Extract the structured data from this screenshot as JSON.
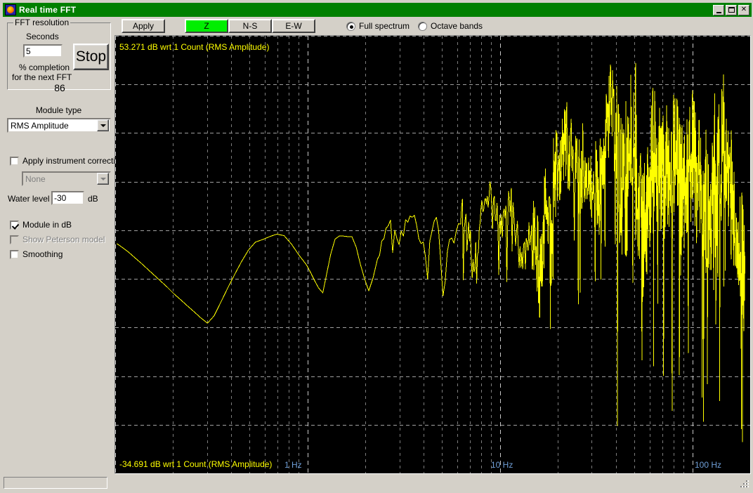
{
  "window": {
    "title": "Real time FFT",
    "icon": "app-icon",
    "buttons": {
      "minimize": "_",
      "maximize": "□",
      "close": "✕"
    }
  },
  "sidebar": {
    "fft_group": {
      "legend": "FFT resolution",
      "seconds_label": "Seconds",
      "seconds_value": "5",
      "stop_button": "Stop",
      "completion_line1": "% completion",
      "completion_line2": "for the next FFT",
      "completion_value": "86"
    },
    "module_type_label": "Module type",
    "module_type_value": "RMS Amplitude",
    "apply_instrument_correction": {
      "label": "Apply instrument correction",
      "checked": false,
      "combo_value": "None",
      "combo_disabled": true
    },
    "water_level": {
      "label": "Water level",
      "value": "-30",
      "unit": "dB"
    },
    "module_in_db": {
      "label": "Module in dB",
      "checked": true,
      "disabled": false
    },
    "show_peterson_model": {
      "label": "Show Peterson model",
      "checked": false,
      "disabled": true
    },
    "smoothing": {
      "label": "Smoothing",
      "checked": false,
      "disabled": false
    }
  },
  "toolbar": {
    "apply_label": "Apply",
    "channel_buttons": [
      {
        "label": "Z",
        "active": true
      },
      {
        "label": "N-S",
        "active": false
      },
      {
        "label": "E-W",
        "active": false
      }
    ],
    "active_channel_color": "#00ee00",
    "spectrum_mode": [
      {
        "label": "Full spectrum",
        "selected": true
      },
      {
        "label": "Octave bands",
        "selected": false
      }
    ]
  },
  "chart_data": {
    "type": "line",
    "title": "",
    "top_label": "53.271 dB wrt 1 Count (RMS Amplitude)",
    "bottom_label": "-34.691 dB wrt 1 Count (RMS Amplitude)",
    "xlabel": "",
    "ylabel": "dB wrt 1 Count (RMS Amplitude)",
    "xscale": "log",
    "xlim": [
      0.1,
      200
    ],
    "ylim": [
      -34.691,
      53.271
    ],
    "ytick_count": 9,
    "grid": true,
    "grid_color": "#a0a0a0",
    "background": "#000000",
    "trace_color": "#ffff00",
    "xticks": [
      {
        "value": 1,
        "label": "1 Hz"
      },
      {
        "value": 10,
        "label": "10 Hz"
      },
      {
        "value": 100,
        "label": "100 Hz"
      }
    ],
    "xtick_label_color": "#6f9fd8",
    "series": [
      {
        "name": "Z",
        "x": [
          0.102,
          0.11,
          0.118,
          0.127,
          0.137,
          0.148,
          0.16,
          0.173,
          0.187,
          0.202,
          0.219,
          0.237,
          0.257,
          0.278,
          0.302,
          0.327,
          0.355,
          0.385,
          0.418,
          0.454,
          0.493,
          0.536,
          0.583,
          0.635,
          0.692,
          0.755,
          0.825,
          0.902,
          0.988,
          1.04,
          1.09,
          1.14,
          1.2,
          1.26,
          1.32,
          1.39,
          1.46,
          1.54,
          1.62,
          1.7,
          1.79,
          1.88,
          1.98,
          2.08,
          2.19,
          2.31,
          2.43,
          2.56,
          2.7,
          2.84,
          2.99,
          3.15,
          3.32,
          3.5,
          3.69,
          3.89,
          4.1,
          4.32,
          4.55,
          4.8,
          5.06,
          5.33,
          5.62,
          5.93,
          6.25,
          6.59,
          6.95,
          7.33,
          7.73,
          8.15,
          8.59,
          9.06,
          9.56,
          10.08,
          10.63,
          11.21,
          11.82,
          12.46,
          13.14,
          13.86,
          14.62,
          15.42,
          16.26,
          17.15,
          18.09,
          19.08,
          20.12,
          21.22,
          22.38,
          23.6,
          24.89,
          26.25,
          27.68,
          29.19,
          30.79,
          32.47,
          34.25,
          36.12,
          38.09,
          40.17,
          42.37,
          44.69,
          47.13,
          49.7,
          52.42,
          55.28,
          58.3,
          61.48,
          64.84,
          68.38,
          72.11,
          76.05,
          80.2,
          84.58,
          89.2,
          94.07,
          99.21,
          104.6,
          110.3,
          116.4,
          122.7,
          129.4,
          136.5,
          144.0,
          151.8,
          160.2,
          169.0,
          178.2,
          187.9,
          198.2
        ],
        "y": [
          11.5,
          10.6,
          9.7,
          8.6,
          7.5,
          6.3,
          5.1,
          3.9,
          2.7,
          1.4,
          0.2,
          -1.0,
          -2.2,
          -3.4,
          -4.5,
          -3.0,
          -0.2,
          2.6,
          5.3,
          7.9,
          10.2,
          11.8,
          12.3,
          12.9,
          13.4,
          13.1,
          11.4,
          9.2,
          7.2,
          5.6,
          4.0,
          2.6,
          1.6,
          5.6,
          9.4,
          12.4,
          13.0,
          13.0,
          12.9,
          12.9,
          10.8,
          7.4,
          4.4,
          2.0,
          4.6,
          8.4,
          12.0,
          14.6,
          16.2,
          14.2,
          11.3,
          13.0,
          15.8,
          16.8,
          15.2,
          11.5,
          8.9,
          12.0,
          16.0,
          14.2,
          1.0,
          9.9,
          12.6,
          14.0,
          15.4,
          16.2,
          12.0,
          5.8,
          9.8,
          17.9,
          21.0,
          19.4,
          16.1,
          13.4,
          16.6,
          20.2,
          17.1,
          10.5,
          6.4,
          11.7,
          15.2,
          11.0,
          4.0,
          17.5,
          21.0,
          24.5,
          26.8,
          29.5,
          31.2,
          28.0,
          24.5,
          26.6,
          28.8,
          26.0,
          21.9,
          24.8,
          30.0,
          34.2,
          40.8,
          31.0,
          24.0,
          20.4,
          26.2,
          29.0,
          22.5,
          12.3,
          18.6,
          27.0,
          29.4,
          28.0,
          24.6,
          27.8,
          31.2,
          26.4,
          20.5,
          24.0,
          28.8,
          26.0,
          22.2,
          18.0,
          14.2,
          20.0,
          27.2,
          30.0,
          24.6,
          19.0,
          14.5,
          9.8,
          5.5
        ]
      }
    ]
  }
}
